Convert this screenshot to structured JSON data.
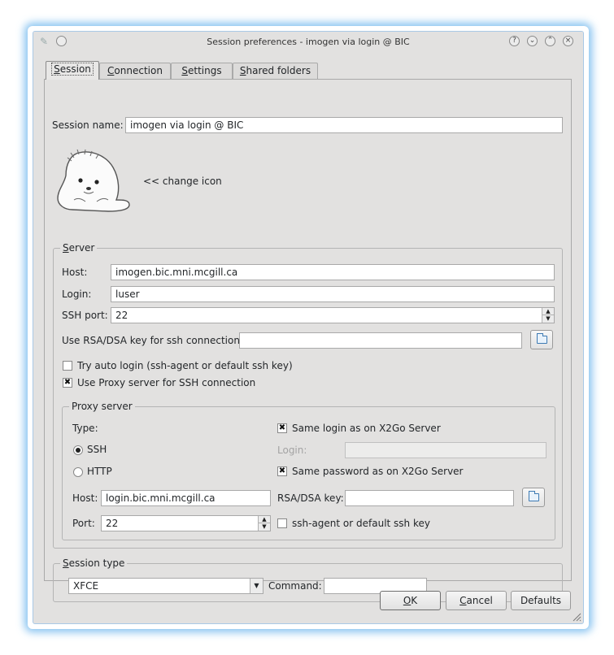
{
  "window": {
    "title": "Session preferences - imogen via login @ BIC",
    "buttons": [
      "?",
      "⌄",
      "⌃",
      "×"
    ]
  },
  "tabs": [
    {
      "label": "Session",
      "mnemonic": "S",
      "rest": "ession",
      "active": true
    },
    {
      "label": "Connection",
      "mnemonic": "C",
      "rest": "onnection",
      "active": false
    },
    {
      "label": "Settings",
      "mnemonic": "S",
      "rest": "ettings",
      "active": false
    },
    {
      "label": "Shared folders",
      "mnemonic": "S",
      "rest": "hared folders",
      "active": false
    }
  ],
  "session": {
    "name_label": "Session name:",
    "name_value": "imogen via login @ BIC",
    "icon": "seal-icon",
    "change_icon_label": "<< change icon"
  },
  "server": {
    "group_title_mnemonic": "S",
    "group_title_rest": "erver",
    "host_label": "Host:",
    "host_value": "imogen.bic.mni.mcgill.ca",
    "login_label": "Login:",
    "login_value": "luser",
    "ssh_port_label": "SSH port:",
    "ssh_port_value": "22",
    "rsa_label": "Use RSA/DSA key for ssh connection:",
    "rsa_value": "",
    "auto_login_label": "Try auto login (ssh-agent or default ssh key)",
    "auto_login_checked": false,
    "use_proxy_label": "Use Proxy server for SSH connection",
    "use_proxy_checked": true
  },
  "proxy": {
    "group_title": "Proxy server",
    "type_label": "Type:",
    "ssh_label": "SSH",
    "http_label": "HTTP",
    "selected_type": "SSH",
    "same_login_label": "Same login as on X2Go Server",
    "same_login_checked": true,
    "login_label": "Login:",
    "login_value": "",
    "same_password_label": "Same password as on X2Go Server",
    "same_password_checked": true,
    "host_label": "Host:",
    "host_value": "login.bic.mni.mcgill.ca",
    "rsa_label": "RSA/DSA key:",
    "rsa_value": "",
    "port_label": "Port:",
    "port_value": "22",
    "ssh_agent_label": "ssh-agent or default ssh key",
    "ssh_agent_checked": false
  },
  "session_type": {
    "group_title_mnemonic": "S",
    "group_title_rest": "ession type",
    "selected": "XFCE",
    "command_label": "Command:",
    "command_value": ""
  },
  "footer": {
    "ok_mnemonic": "O",
    "ok_rest": "K",
    "cancel_mnemonic": "C",
    "cancel_rest": "ancel",
    "defaults_label": "Defaults"
  }
}
